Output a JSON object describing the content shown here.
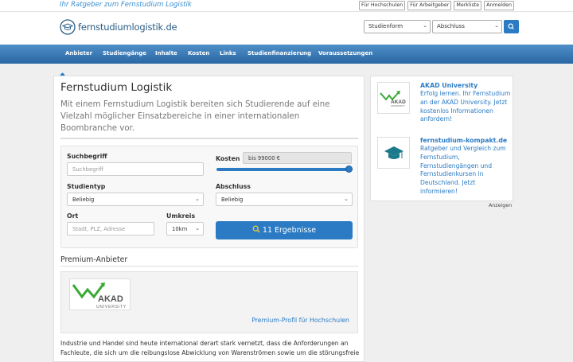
{
  "topbar": {
    "tagline": "Ihr Ratgeber zum Fernstudium Logistik",
    "links": [
      "Für Hochschulen",
      "Für Arbeitgeber",
      "Merkliste",
      "Anmelden"
    ]
  },
  "header": {
    "logo_text": "fernstudiumlogistik.de",
    "select_studienform": "Studienform",
    "select_abschluss": "Abschluss",
    "search_icon": "search-icon"
  },
  "nav": {
    "items": [
      "Anbieter",
      "Studiengänge",
      "Inhalte",
      "Kosten",
      "Links",
      "Studienfinanzierung",
      "Voraussetzungen"
    ]
  },
  "breadcrumb": {
    "icon": "home-icon"
  },
  "main": {
    "title": "Fernstudium Logistik",
    "lead": "Mit einem Fernstudium Logistik bereiten sich Studierende auf eine Vielzahl möglicher Einsatzbereiche in einer internationalen Boombranche vor.",
    "form": {
      "suchbegriff_label": "Suchbegriff",
      "suchbegriff_placeholder": "Suchbegriff",
      "kosten_label": "Kosten",
      "kosten_value": "bis 99000 €",
      "kosten_slider_fraction": 1.0,
      "studientyp_label": "Studientyp",
      "studientyp_value": "Beliebig",
      "abschluss_label": "Abschluss",
      "abschluss_value": "Beliebig",
      "ort_label": "Ort",
      "ort_placeholder": "Stadt, PLZ, Adresse",
      "umkreis_label": "Umkreis",
      "umkreis_value": "10km",
      "results_button": "11 Ergebnisse"
    },
    "premium": {
      "title": "Premium-Anbieter",
      "logo_text": "AKAD",
      "logo_subtext": "UNIVERSITY",
      "link": "Premium-Profil für Hochschulen"
    },
    "body_text": "Industrie und Handel sind heute international derart stark vernetzt, dass die Anforderungen an Fachleute, die sich um die reibungslose Abwicklung von Warenströmen sowie um die störungsfreie"
  },
  "sidebar": {
    "ads": [
      {
        "title": "AKAD University",
        "text": "Erfolg lernen. Ihr Fernstudium an der AKAD University. Jetzt kostenlos Informationen anfordern!",
        "icon": "akad-logo"
      },
      {
        "title": "fernstudium-kompakt.de",
        "text": "Ratgeber und Vergleich zum Fernstudium, Fernstudiengängen und Fernstudienkursen in Deutschland. Jetzt informieren!",
        "icon": "graduation-cap-icon"
      }
    ],
    "anzeigen_label": "Anzeigen"
  },
  "colors": {
    "accent": "#2a7bc4",
    "nav": "#3a7ab8",
    "akad_green": "#3aa935"
  }
}
